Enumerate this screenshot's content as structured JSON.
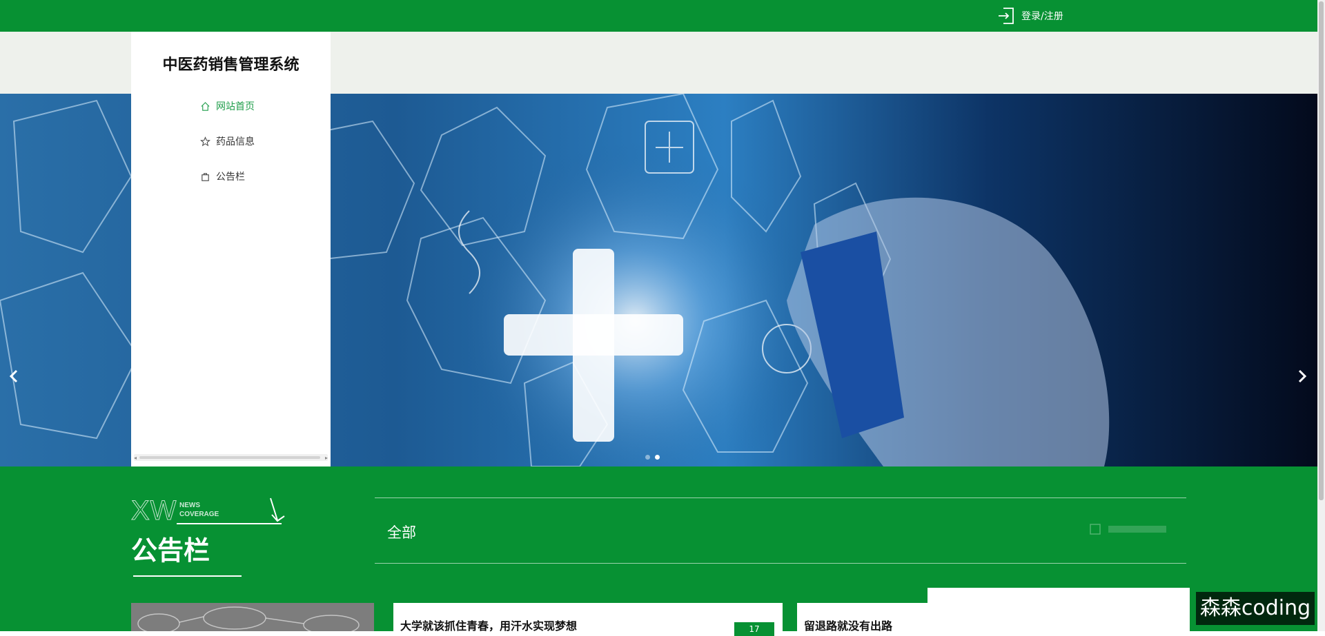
{
  "header": {
    "login_label": "登录/注册"
  },
  "sidebar": {
    "title": "中医药销售管理系统",
    "items": [
      {
        "label": "网站首页",
        "icon": "home-icon",
        "active": true
      },
      {
        "label": "药品信息",
        "icon": "star-icon",
        "active": false
      },
      {
        "label": "公告栏",
        "icon": "bag-icon",
        "active": false
      }
    ]
  },
  "carousel": {
    "slide_count": 2,
    "active_index": 1
  },
  "news": {
    "logo_letters": "XW",
    "logo_small_1": "NEWS",
    "logo_small_2": "COVERAGE",
    "title": "公告栏",
    "tab_all": "全部",
    "cards": [
      {
        "title": "大学就该抓住青春，用汗水实现梦想",
        "badge": "17"
      },
      {
        "title": "留退路就没有出路"
      }
    ]
  },
  "watermark": "森森coding",
  "colors": {
    "brand_green": "#079133",
    "active_nav": "#1f9d4a"
  }
}
